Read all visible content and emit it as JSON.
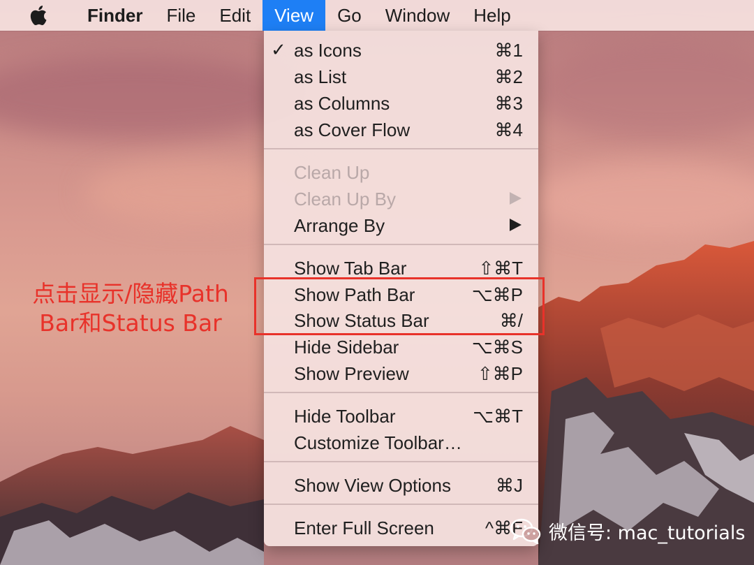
{
  "menubar": {
    "items": [
      {
        "label": "Finder",
        "bold": true
      },
      {
        "label": "File"
      },
      {
        "label": "Edit"
      },
      {
        "label": "View",
        "active": true
      },
      {
        "label": "Go"
      },
      {
        "label": "Window"
      },
      {
        "label": "Help"
      }
    ],
    "active_color": "#1e7ff5"
  },
  "view_menu": {
    "groups": [
      [
        {
          "label": "as Icons",
          "shortcut": "⌘1",
          "checked": true
        },
        {
          "label": "as List",
          "shortcut": "⌘2"
        },
        {
          "label": "as Columns",
          "shortcut": "⌘3"
        },
        {
          "label": "as Cover Flow",
          "shortcut": "⌘4"
        }
      ],
      [
        {
          "label": "Clean Up",
          "disabled": true
        },
        {
          "label": "Clean Up By",
          "disabled": true,
          "submenu": true
        },
        {
          "label": "Arrange By",
          "submenu": true
        }
      ],
      [
        {
          "label": "Show Tab Bar",
          "shortcut": "⇧⌘T"
        },
        {
          "label": "Show Path Bar",
          "shortcut": "⌥⌘P"
        },
        {
          "label": "Show Status Bar",
          "shortcut": "⌘/"
        },
        {
          "label": "Hide Sidebar",
          "shortcut": "⌥⌘S"
        },
        {
          "label": "Show Preview",
          "shortcut": "⇧⌘P"
        }
      ],
      [
        {
          "label": "Hide Toolbar",
          "shortcut": "⌥⌘T"
        },
        {
          "label": "Customize Toolbar…"
        }
      ],
      [
        {
          "label": "Show View Options",
          "shortcut": "⌘J"
        }
      ],
      [
        {
          "label": "Enter Full Screen",
          "shortcut": "^⌘F"
        }
      ]
    ]
  },
  "annotation": {
    "text_line1": "点击显示/隐藏Path",
    "text_line2": "Bar和Status Bar",
    "color": "#e8322a"
  },
  "watermark": {
    "text": "微信号: mac_tutorials",
    "icon": "wechat-icon"
  },
  "icons": {
    "apple": "apple-logo-icon",
    "check": "checkmark-icon",
    "submenu": "submenu-arrow-icon"
  }
}
